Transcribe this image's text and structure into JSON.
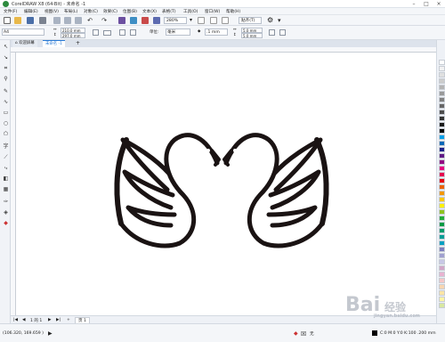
{
  "window": {
    "title": "CorelDRAW X8 (64-Bit) - 未命名 -1"
  },
  "menu": [
    "文件(F)",
    "编辑(E)",
    "视图(V)",
    "布局(L)",
    "对象(C)",
    "效果(C)",
    "位图(B)",
    "文本(X)",
    "表格(T)",
    "工具(O)",
    "窗口(W)",
    "帮助(H)"
  ],
  "toolbar": {
    "zoom_value": "280%",
    "snap_label": "贴齐(T)"
  },
  "propbar": {
    "page_size": "A4",
    "width_value": "210.0 mm",
    "height_value": "297.0 mm",
    "units_label": "单位:",
    "units_value": "毫米",
    "nudge_value": ".1 mm",
    "dup_x_value": "5.0 mm",
    "dup_y_value": "5.0 mm"
  },
  "tabs": [
    {
      "label": "欢迎屏幕"
    },
    {
      "label": "未命名 -1"
    }
  ],
  "pagenav": {
    "page_counter": "1 的 1",
    "page_tab": "页 1"
  },
  "status": {
    "coordinates": "(106.320, 169.659 )",
    "fill_label": "无",
    "color_info": "C:0 M:0 Y:0 K:100  .200 mm"
  },
  "watermark": {
    "text": "Bai",
    "sub": "经验",
    "url": "jingyan.baidu.com"
  },
  "palette": [
    "#ffffff",
    "#f2f2f2",
    "#e0e0e0",
    "#cccccc",
    "#b3b3b3",
    "#999999",
    "#808080",
    "#666666",
    "#4d4d4d",
    "#333333",
    "#1a1a1a",
    "#000000",
    "#00a0e9",
    "#0068b7",
    "#1d2088",
    "#601986",
    "#920783",
    "#e4007f",
    "#e5004f",
    "#e60012",
    "#eb6100",
    "#f39800",
    "#fcc800",
    "#fff100",
    "#8fc31f",
    "#22ac38",
    "#009944",
    "#009b6b",
    "#009e96",
    "#00a0c1",
    "#7d7dbd",
    "#a0a0d0",
    "#c8c8e6",
    "#d2a6c7",
    "#e8b3d0",
    "#f5c7c7",
    "#f8d5b0",
    "#fbe5a5",
    "#fff5a5",
    "#d8e8a0"
  ],
  "colors": {
    "swan": "#1a1313",
    "accent": "#2d8a3e"
  }
}
